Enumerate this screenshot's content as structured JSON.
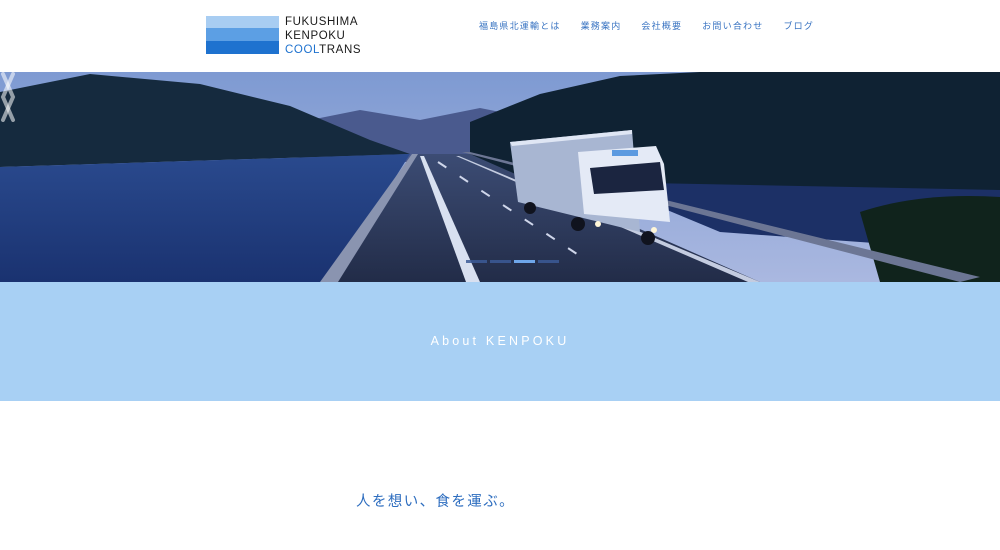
{
  "logo": {
    "line1": "FUKUSHIMA",
    "line2": "KENPOKU",
    "line3_cool": "COOL",
    "line3_trans": "TRANS",
    "colors": [
      "#a8cdf2",
      "#5c9fe4",
      "#1e72cf"
    ]
  },
  "nav": {
    "items": [
      {
        "label": "福島県北運輸とは"
      },
      {
        "label": "業務案内"
      },
      {
        "label": "会社概要"
      },
      {
        "label": "お問い合わせ"
      },
      {
        "label": "ブログ"
      }
    ]
  },
  "hero": {
    "prev_icon": "chevron-left-icon",
    "next_icon": "chevron-right-icon",
    "slide_count": 4,
    "active_slide": 2
  },
  "about": {
    "title": "About KENPOKU",
    "band_color": "#a8d0f4"
  },
  "tagline": "人を想い、食を運ぶ。",
  "colors": {
    "accent": "#2d6dbf",
    "nav": "#3a74c2"
  }
}
